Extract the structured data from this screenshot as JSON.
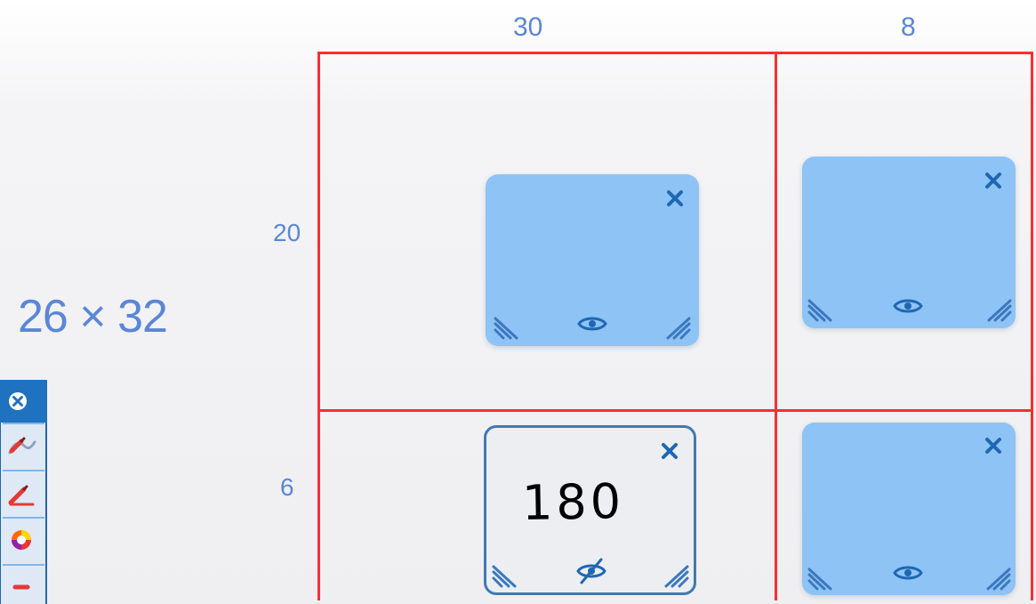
{
  "canvas": {
    "summary": "26 × 32",
    "column_labels": [
      "30",
      "8"
    ],
    "row_labels": [
      "20",
      "6"
    ]
  },
  "tiles": [
    {
      "name": "tile-top-left",
      "state": "visible",
      "close_icon": "close-icon",
      "visibility_icon": "eye-icon",
      "note": ""
    },
    {
      "name": "tile-top-right",
      "state": "visible",
      "close_icon": "close-icon",
      "visibility_icon": "eye-icon",
      "note": ""
    },
    {
      "name": "tile-bottom-left",
      "state": "hidden",
      "close_icon": "close-icon",
      "visibility_icon": "eye-slash-icon",
      "note": "180"
    },
    {
      "name": "tile-bottom-right",
      "state": "visible",
      "close_icon": "close-icon",
      "visibility_icon": "eye-icon",
      "note": ""
    }
  ],
  "toolbar": {
    "items": [
      "close-icon",
      "pen-curve-icon",
      "pen-icon",
      "color-wheel-icon",
      "more-tools-icon"
    ]
  },
  "colors": {
    "label_blue": "#5b86d8",
    "grid_red": "#ff2d2d",
    "tile_blue": "#8ec3f6",
    "tile_border": "#3f79b6",
    "icon_blue": "#1f67b2"
  }
}
